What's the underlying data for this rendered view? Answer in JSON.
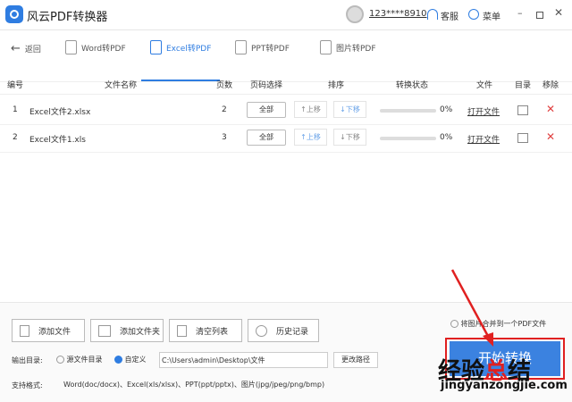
{
  "app": {
    "title": "风云PDF转换器",
    "user": "123****8910",
    "service": "客服",
    "menu": "菜单"
  },
  "nav": {
    "back": "返回",
    "tabs": [
      {
        "label": "Word转PDF"
      },
      {
        "label": "Excel转PDF"
      },
      {
        "label": "PPT转PDF"
      },
      {
        "label": "图片转PDF"
      }
    ],
    "active": 1
  },
  "table": {
    "headers": [
      "编号",
      "文件名称",
      "页数",
      "页码选择",
      "排序",
      "转换状态",
      "文件",
      "目录",
      "移除"
    ],
    "rows": [
      {
        "no": "1",
        "name": "Excel文件2.xlsx",
        "pages": "2",
        "range": "全部",
        "up": "↑上移",
        "down": "↓下移",
        "progress": "0%",
        "open": "打开文件"
      },
      {
        "no": "2",
        "name": "Excel文件1.xls",
        "pages": "3",
        "range": "全部",
        "up": "↑上移",
        "down": "↓下移",
        "progress": "0%",
        "open": "打开文件"
      }
    ]
  },
  "actions": {
    "add_file": "添加文件",
    "add_folder": "添加文件夹",
    "clear": "清空列表",
    "history": "历史记录"
  },
  "merge_option": "将图片合并到一个PDF文件",
  "output": {
    "label": "输出目录:",
    "source": "源文件目录",
    "custom": "自定义",
    "path": "C:\\Users\\admin\\Desktop\\文件",
    "change": "更改路径"
  },
  "formats": {
    "label": "支持格式:",
    "value": "Word(doc/docx)、Excel(xls/xlsx)、PPT(ppt/pptx)、图片(jpg/jpeg/png/bmp)"
  },
  "start": "开始转换",
  "watermark": {
    "a": "经验",
    "b": "总",
    "c": "结",
    "url": "jingyanzongjie.com"
  },
  "colors": {
    "accent": "#2f7de1",
    "annotation": "#e02020"
  }
}
